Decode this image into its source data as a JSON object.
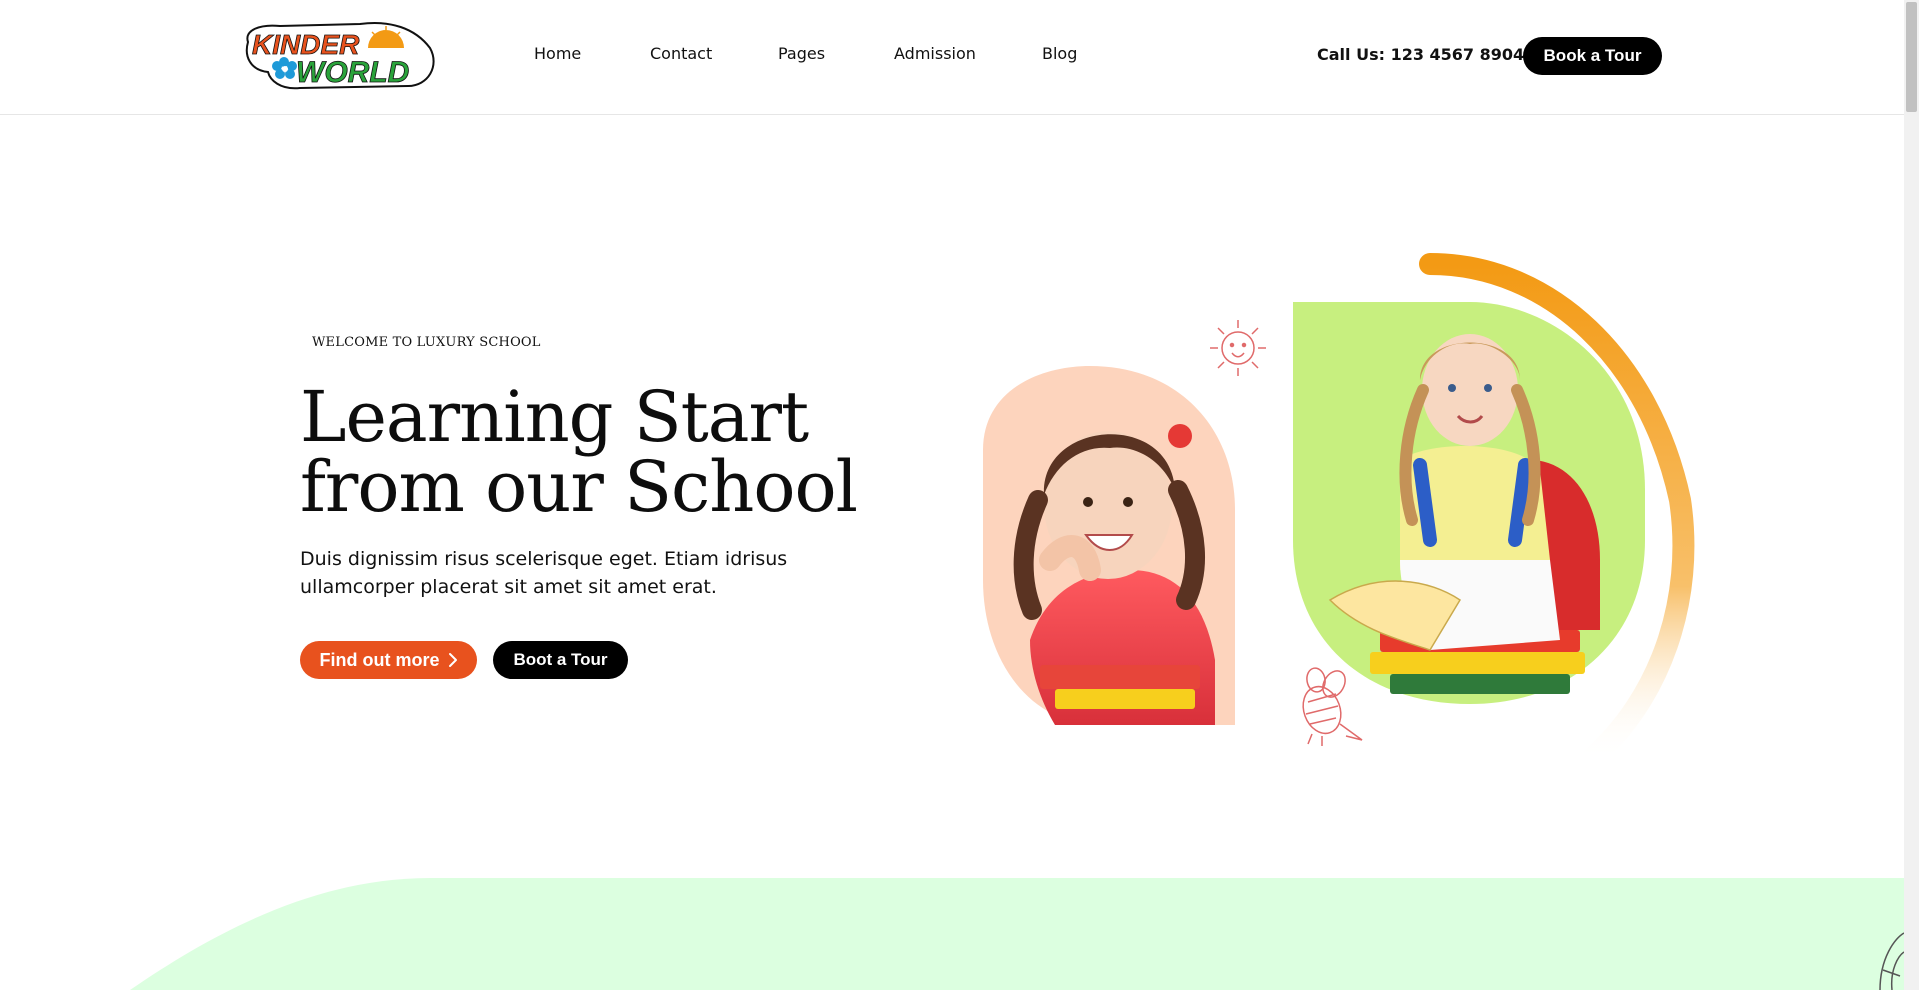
{
  "brand": {
    "logo_line1": "KINDER",
    "logo_line2": "WORLD",
    "colors": {
      "orange": "#e8521e",
      "green": "#2aa33b",
      "sun": "#f39a14"
    }
  },
  "nav": {
    "items": [
      {
        "label": "Home"
      },
      {
        "label": "Contact"
      },
      {
        "label": "Pages"
      },
      {
        "label": "Admission"
      },
      {
        "label": "Blog"
      }
    ]
  },
  "header": {
    "phone": "Call Us: 123 4567 8904",
    "cta_label": "Book a Tour"
  },
  "hero": {
    "eyebrow": "WELCOME TO LUXURY SCHOOL",
    "title_line1": "Learning Start",
    "title_line2": "from our School",
    "lead": "Duis dignissim risus scelerisque eget. Etiam idrisus ullamcorper placerat sit amet sit amet erat.",
    "primary_button": "Find out more",
    "secondary_button": "Boot a Tour",
    "accent_color": "#e8521e",
    "icons": [
      "sun-doodle-icon",
      "bee-doodle-icon",
      "chevron-right-icon"
    ]
  },
  "images": {
    "left_photo_bg": "#fdd4bd",
    "right_photo_bg": "#c7ef7f",
    "arc_color": "#f39a14",
    "band_color": "#dcffe0"
  }
}
